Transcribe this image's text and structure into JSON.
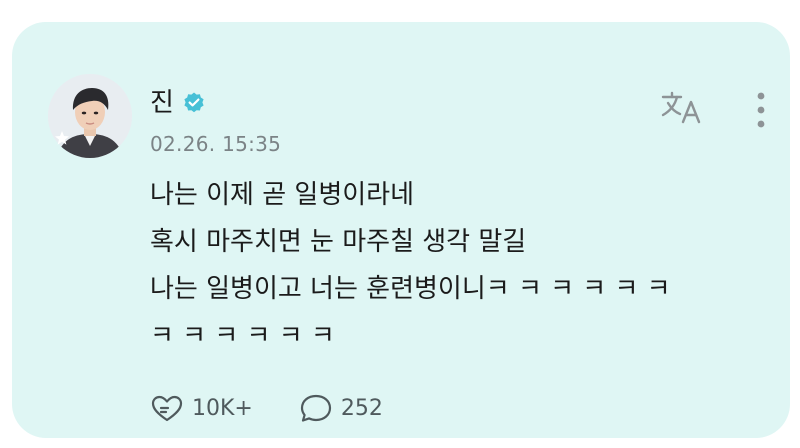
{
  "post": {
    "author_name": "진",
    "timestamp": "02.26. 15:35",
    "lines": [
      "나는 이제 곧 일병이라네",
      "혹시 마주치면 눈 마주칠 생각 말길",
      "나는 일병이고 너는 훈련병이니ㅋ ㅋ ㅋ ㅋ ㅋ ㅋ",
      "ㅋ ㅋ ㅋ ㅋ ㅋ ㅋ"
    ],
    "like_count": "10K+",
    "comment_count": "252"
  },
  "icons": {
    "avatar": "profile-photo",
    "verified": "verified-badge-icon",
    "translate": "translate-icon",
    "more": "more-vertical-icon",
    "like": "heart-like-icon",
    "comment": "comment-bubble-icon"
  },
  "colors": {
    "card_background": "#dff6f4",
    "verified_badge": "#47c0d6",
    "muted_text": "#7b8386"
  }
}
